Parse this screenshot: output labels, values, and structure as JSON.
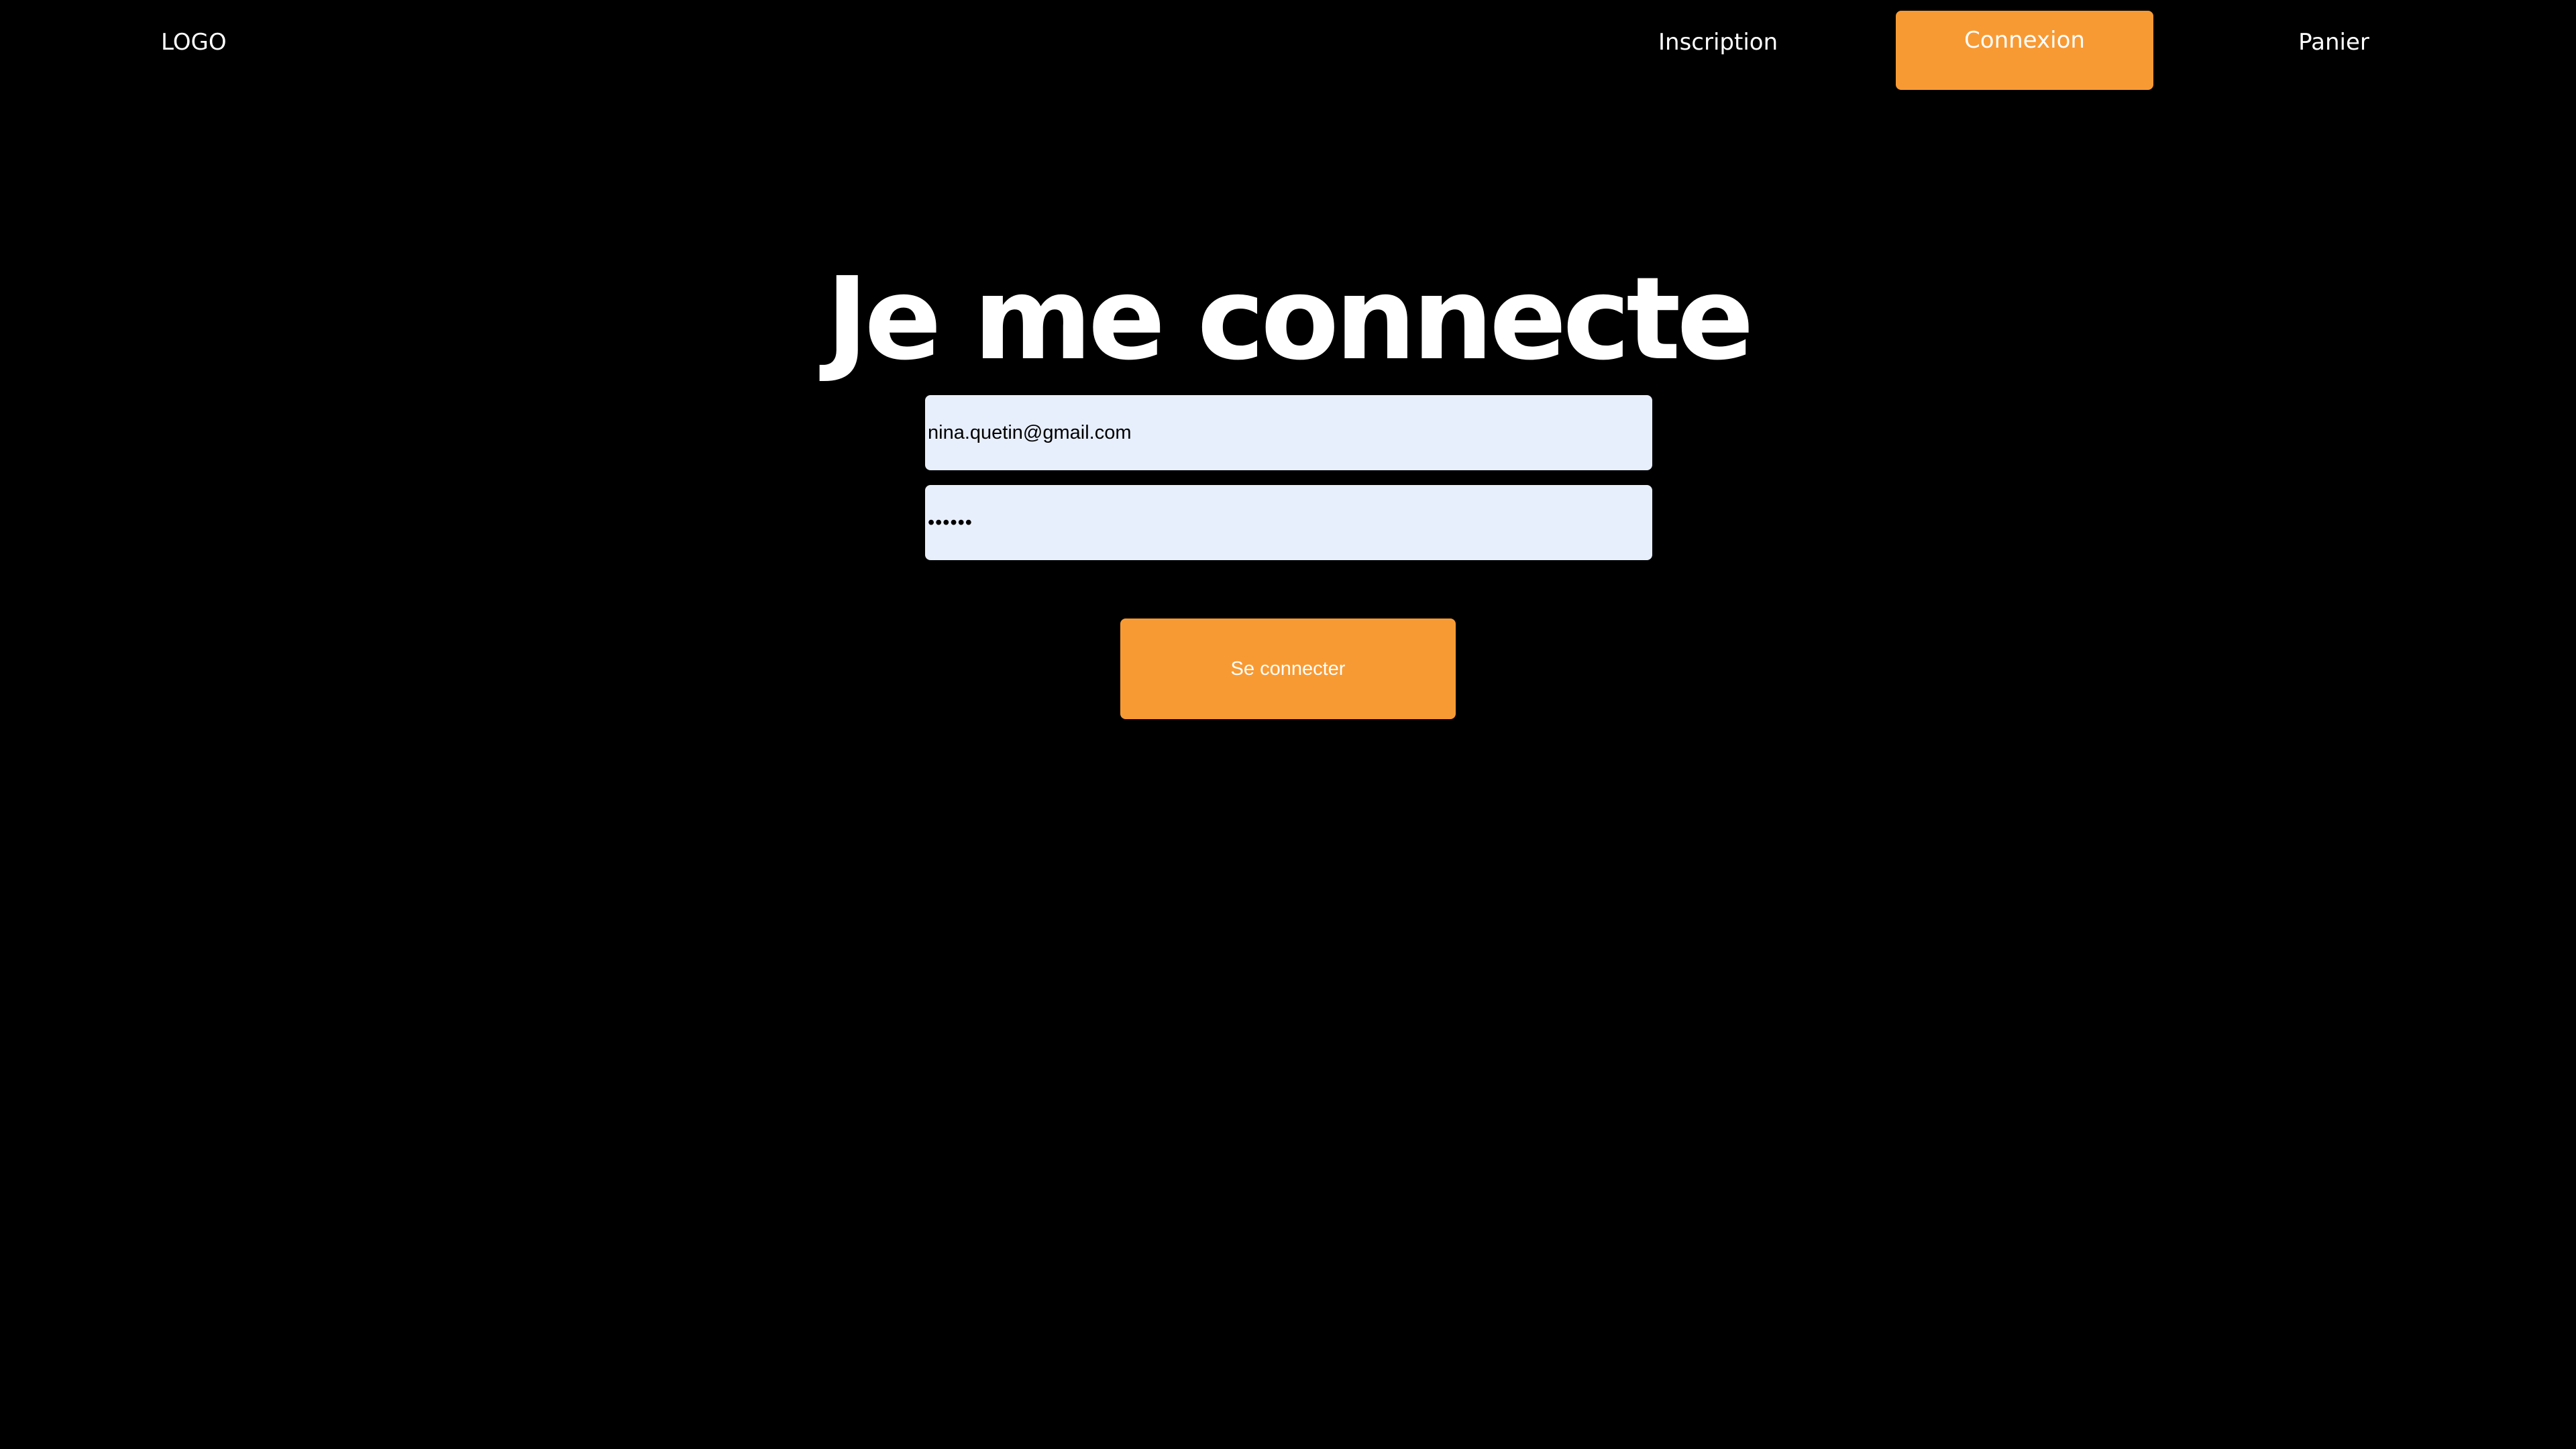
{
  "header": {
    "logo": "LOGO",
    "nav": {
      "inscription": "Inscription",
      "connexion": "Connexion",
      "panier": "Panier"
    }
  },
  "main": {
    "title": "Je me connecte",
    "form": {
      "email_value": "nina.quetin@gmail.com",
      "password_value": "••••••",
      "submit_label": "Se connecter"
    }
  },
  "colors": {
    "background": "#000000",
    "accent": "#f89a33",
    "input_background": "#e8effc",
    "text": "#ffffff"
  }
}
